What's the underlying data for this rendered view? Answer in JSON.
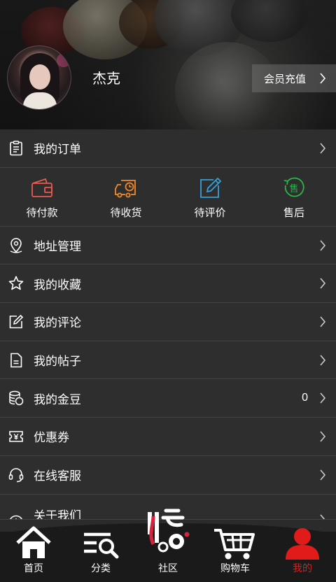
{
  "profile": {
    "username": "杰克",
    "recharge_label": "会员充值"
  },
  "orders": {
    "label": "我的订单",
    "items": [
      {
        "label": "待付款",
        "icon": "wallet-icon",
        "color": "#e85a4f"
      },
      {
        "label": "待收货",
        "icon": "delivery-truck-icon",
        "color": "#f08a2c"
      },
      {
        "label": "待评价",
        "icon": "edit-review-icon",
        "color": "#3a9fd6"
      },
      {
        "label": "售后",
        "icon": "after-sale-icon",
        "color": "#2fb24c",
        "glyph": "售"
      }
    ]
  },
  "menu": [
    {
      "label": "地址管理",
      "icon": "location-pin-icon"
    },
    {
      "label": "我的收藏",
      "icon": "star-icon"
    },
    {
      "label": "我的评论",
      "icon": "comment-edit-icon"
    },
    {
      "label": "我的帖子",
      "icon": "document-icon"
    },
    {
      "label": "我的金豆",
      "icon": "coins-icon",
      "value": "0"
    },
    {
      "label": "优惠券",
      "icon": "coupon-icon"
    },
    {
      "label": "在线客服",
      "icon": "headset-icon"
    },
    {
      "label": "关于我们",
      "icon": "info-icon"
    }
  ],
  "tabbar": {
    "items": [
      {
        "label": "首页",
        "icon": "home-icon"
      },
      {
        "label": "分类",
        "icon": "category-search-icon"
      },
      {
        "label": "社区",
        "icon": "community-logo-icon"
      },
      {
        "label": "购物车",
        "icon": "cart-icon"
      },
      {
        "label": "我的",
        "icon": "person-icon",
        "active": true
      }
    ],
    "active_color": "#e11a1a"
  }
}
